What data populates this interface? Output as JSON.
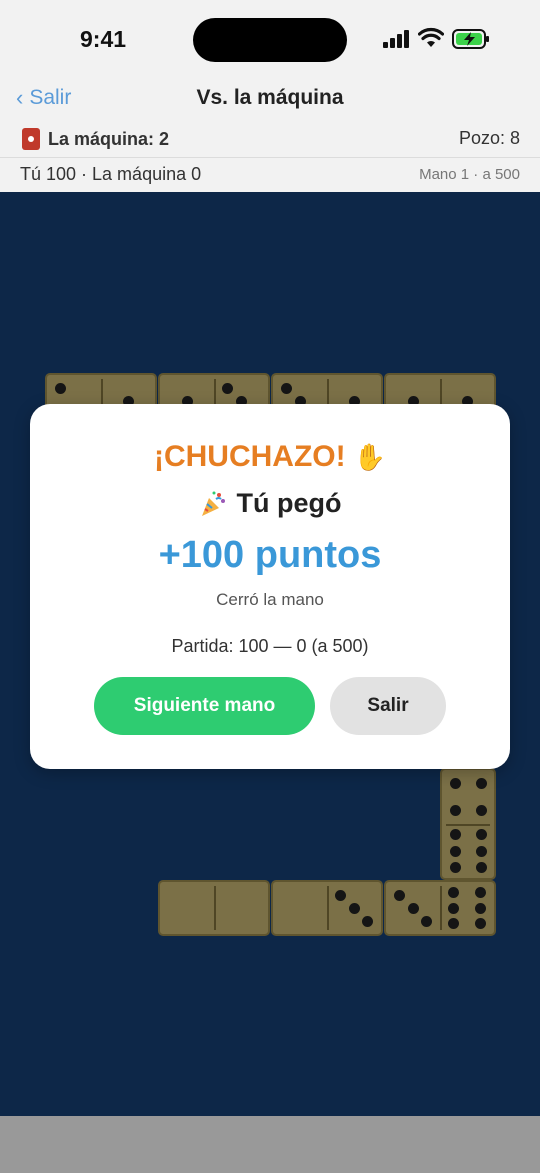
{
  "status_bar": {
    "time": "9:41",
    "icons": [
      "signal-icon",
      "wifi-icon",
      "battery-charging-icon"
    ],
    "battery_color": "#3cd24a"
  },
  "nav": {
    "back_label": "Salir",
    "title": "Vs. la máquina"
  },
  "info": {
    "opponent": "La máquina: 2",
    "pool": "Pozo: 8",
    "score": "Tú 100 · La máquina 0",
    "hand": "Mano 1 · a 500"
  },
  "board": {
    "background": "#0d2748",
    "tiles": [
      {
        "a": 2,
        "b": 1,
        "orientation": "horizontal"
      },
      {
        "a": 1,
        "b": 3,
        "orientation": "horizontal"
      },
      {
        "a": 3,
        "b": 1,
        "orientation": "horizontal"
      },
      {
        "a": 1,
        "b": 1,
        "orientation": "horizontal"
      },
      {
        "a": 4,
        "b": 6,
        "orientation": "vertical"
      },
      {
        "a": 0,
        "b": 0,
        "orientation": "horizontal"
      },
      {
        "a": 0,
        "b": 3,
        "orientation": "horizontal"
      },
      {
        "a": 3,
        "b": 6,
        "orientation": "horizontal"
      }
    ]
  },
  "modal": {
    "title": "¡CHUCHAZO!",
    "title_icon": "raised-hand-icon",
    "subtitle": "Tú pegó",
    "subtitle_icon": "party-popper-icon",
    "points": "+100 puntos",
    "reason": "Cerró la mano",
    "match": "Partida: 100 — 0 (a 500)",
    "primary_button": "Siguiente mano",
    "secondary_button": "Salir",
    "colors": {
      "title": "#e67e22",
      "points": "#3a98d8",
      "primary": "#2ecc71"
    }
  }
}
